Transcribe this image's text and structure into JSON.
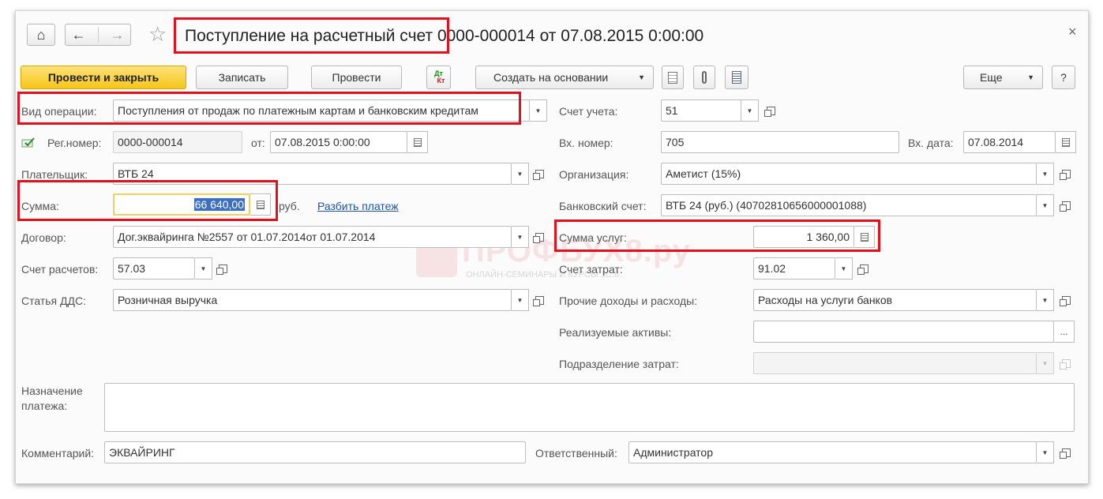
{
  "window": {
    "title": "Поступление на расчетный счет 0000-000014 от 07.08.2015 0:00:00",
    "title_part1": "Поступление на расчетный счет",
    "title_part2": " 0000-000014 от 07.08.2015 0:00:00",
    "close_glyph": "×"
  },
  "nav": {
    "home_glyph": "⌂",
    "back_glyph": "←",
    "forward_glyph": "→",
    "star_glyph": "☆"
  },
  "toolbar": {
    "post_close": "Провести и закрыть",
    "save": "Записать",
    "post": "Провести",
    "create_based": "Создать на основании",
    "more": "Еще",
    "help": "?",
    "dt_kt_top": "Дт",
    "dt_kt_bottom": "Кт",
    "dropdown_glyph": "▼"
  },
  "form": {
    "operation": {
      "label": "Вид операции:",
      "value": "Поступления от продаж по платежным картам и банковским кредитам"
    },
    "reg_number": {
      "label": "Рег.номер:",
      "value": "0000-000014"
    },
    "date_from": {
      "label": "от:",
      "value": "07.08.2015  0:00:00"
    },
    "payer": {
      "label": "Плательщик:",
      "value": "ВТБ 24"
    },
    "amount": {
      "label": "Сумма:",
      "value": "66 640,00",
      "currency": "руб.",
      "split_link": "Разбить платеж"
    },
    "contract": {
      "label": "Договор:",
      "value": "Дог.эквайринга №2557 от 01.07.2014от 01.07.2014"
    },
    "settlement_account": {
      "label": "Счет расчетов:",
      "value": "57.03"
    },
    "cash_flow_item": {
      "label": "Статья ДДС:",
      "value": "Розничная выручка"
    },
    "account": {
      "label": "Счет учета:",
      "value": "51"
    },
    "incoming_number": {
      "label": "Вх. номер:",
      "value": "705"
    },
    "incoming_date": {
      "label": "Вх. дата:",
      "value": "07.08.2014"
    },
    "organization": {
      "label": "Организация:",
      "value": "Аметист (15%)"
    },
    "bank_account": {
      "label": "Банковский счет:",
      "value": "ВТБ 24 (руб.) (40702810656000001088)"
    },
    "service_amount": {
      "label": "Сумма услуг:",
      "value": "1 360,00"
    },
    "expense_account": {
      "label": "Счет затрат:",
      "value": "91.02"
    },
    "other_income_expenses": {
      "label": "Прочие доходы и расходы:",
      "value": "Расходы на услуги банков"
    },
    "sold_assets": {
      "label": "Реализуемые активы:",
      "value": "",
      "button": "..."
    },
    "cost_department": {
      "label": "Подразделение затрат:",
      "value": ""
    },
    "purpose": {
      "label_line1": "Назначение",
      "label_line2": "платежа:",
      "value": ""
    },
    "comment": {
      "label": "Комментарий:",
      "value": "ЭКВАЙРИНГ"
    },
    "responsible": {
      "label": "Ответственный:",
      "value": "Администратор"
    }
  },
  "watermark": {
    "text": "ПРОФБУХ8.ру",
    "subtext": "ОНЛАЙН-СЕМИНАРЫ И КУРСЫ 1С:8"
  },
  "colors": {
    "highlight": "#e3101d",
    "primary_button": "#f5c518",
    "link": "#1c55a6"
  }
}
